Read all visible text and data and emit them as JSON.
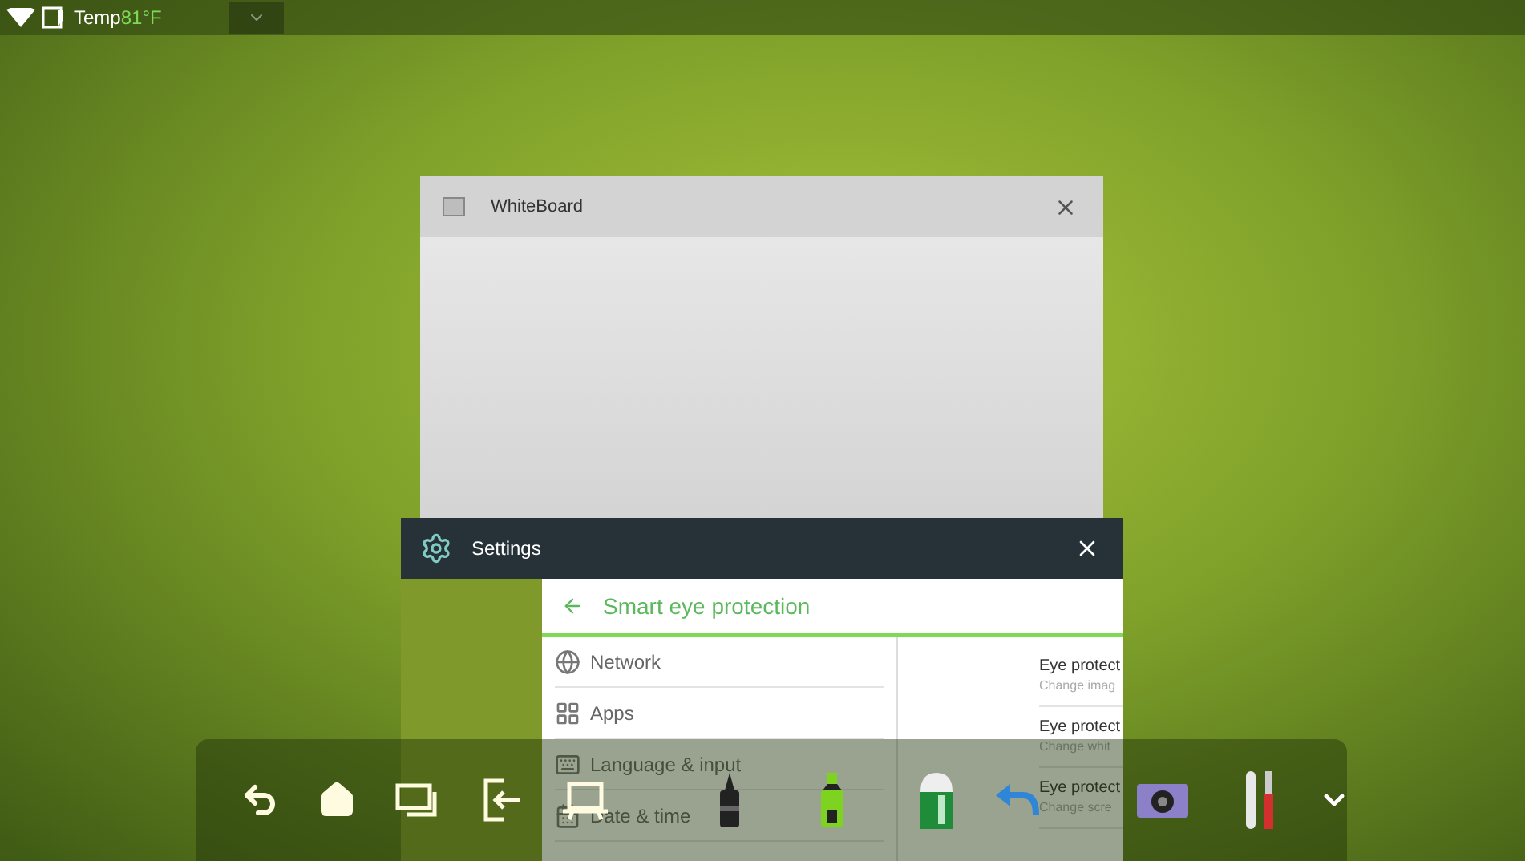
{
  "status_bar": {
    "temp_label": "Temp",
    "temp_value": "81°F"
  },
  "whiteboard_window": {
    "title": "WhiteBoard"
  },
  "settings_window": {
    "title": "Settings",
    "page_title": "Smart eye protection",
    "menu": [
      {
        "kind": "globe",
        "label": "Network"
      },
      {
        "kind": "grid",
        "label": "Apps"
      },
      {
        "kind": "keyboard",
        "label": "Language & input"
      },
      {
        "kind": "calendar",
        "label": "Date & time"
      }
    ],
    "options": [
      {
        "title": "Eye protect",
        "subtitle": "Change imag"
      },
      {
        "title": "Eye protect",
        "subtitle": "Change whit"
      },
      {
        "title": "Eye protect",
        "subtitle": "Change scre"
      }
    ]
  }
}
